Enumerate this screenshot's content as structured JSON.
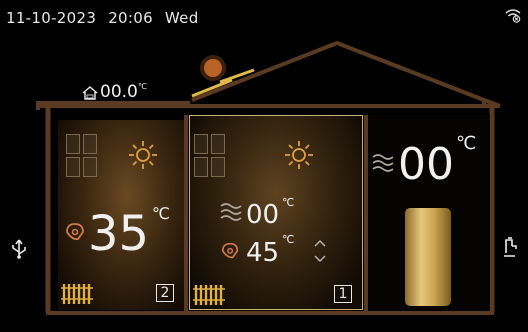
{
  "status_bar": {
    "date": "11-10-2023",
    "time": "20:06",
    "weekday": "Wed"
  },
  "outdoor": {
    "value": "00.0",
    "unit": "℃",
    "icon": "outdoor-house-icon"
  },
  "room_2": {
    "temperature": "35",
    "unit": "℃",
    "badge": "2",
    "icons": [
      "window-icon",
      "sun-icon",
      "heat-source-icon",
      "radiator-icon"
    ]
  },
  "room_1": {
    "flow_temperature": "00",
    "flow_unit": "℃",
    "set_temperature": "45",
    "set_unit": "℃",
    "badge": "1",
    "icons": [
      "window-icon",
      "sun-icon",
      "heat-wave-icon",
      "heat-source-icon",
      "up-down-arrows-icon",
      "radiator-icon"
    ]
  },
  "hot_water": {
    "temperature": "00",
    "unit": "℃",
    "icons": [
      "heat-wave-icon",
      "water-tank-icon"
    ]
  },
  "side_controls": {
    "left_icon": "usb-icon",
    "right_icon": "tap-icon"
  },
  "colors": {
    "accent_gold": "#d8b25a",
    "outline": "#5a3b22",
    "background": "#000000"
  }
}
